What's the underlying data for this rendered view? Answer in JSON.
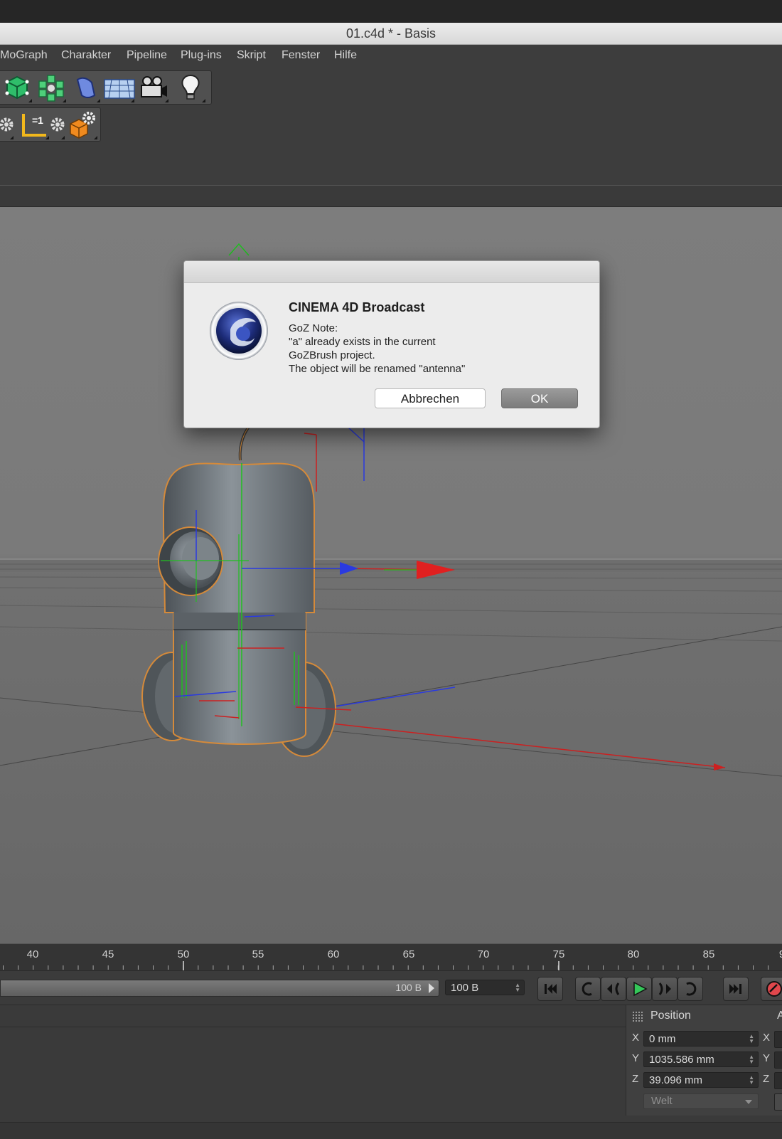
{
  "window": {
    "title": "01.c4d * - Basis"
  },
  "menu": {
    "items": [
      "MoGraph",
      "Charakter",
      "Pipeline",
      "Plug-ins",
      "Skript",
      "Fenster",
      "Hilfe"
    ]
  },
  "toolbar": {
    "row1_icons": [
      "polygon-cube-icon",
      "cloner-icon",
      "deformer-icon",
      "floor-grid-icon",
      "camera-icon",
      "light-bulb-icon"
    ],
    "row2_icons": [
      "settings-gear-icon",
      "axis-snap-icon",
      "settings-gear-icon",
      "cube-settings-icon"
    ]
  },
  "dialog": {
    "app_name": "CINEMA 4D Broadcast",
    "lines": [
      "GoZ Note:",
      "\"a\" already exists in the current",
      "GoZBrush project.",
      "The object will be renamed \"antenna\""
    ],
    "cancel_label": "Abbrechen",
    "ok_label": "OK"
  },
  "timeline": {
    "ticks": [
      "40",
      "45",
      "50",
      "55",
      "60",
      "65",
      "70",
      "75",
      "80",
      "85",
      "9"
    ]
  },
  "transport": {
    "scrubber_label": "100 B",
    "frame_field": "100 B",
    "buttons": [
      "go-to-start-icon",
      "previous-key-icon",
      "previous-frame-icon",
      "play-icon",
      "next-frame-icon",
      "next-key-icon",
      "go-to-end-icon",
      "record-icon"
    ]
  },
  "coordinates": {
    "header": "Position",
    "header2": "A",
    "rows": [
      {
        "axis": "X",
        "value": "0 mm",
        "axis2": "X"
      },
      {
        "axis": "Y",
        "value": "1035.586 mm",
        "axis2": "Y"
      },
      {
        "axis": "Z",
        "value": "39.096 mm",
        "axis2": "Z"
      }
    ],
    "space": "Welt"
  },
  "colors": {
    "accent_play": "#34c759",
    "record": "#e0474c",
    "axis_x": "#e02020",
    "axis_y": "#20d020",
    "axis_z": "#2a3ae0",
    "selection": "#d58a3a"
  }
}
